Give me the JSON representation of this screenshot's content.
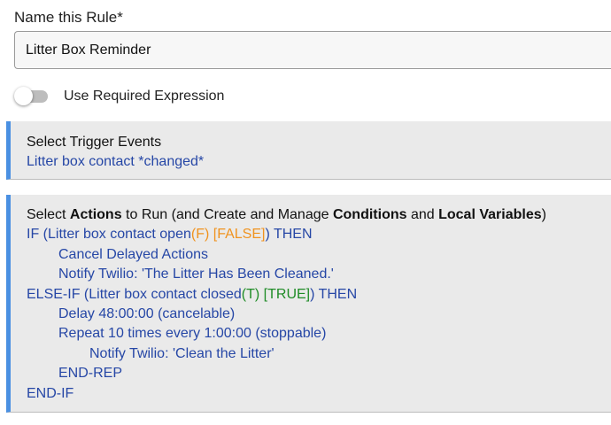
{
  "rule_name": {
    "label": "Name this Rule*",
    "value": "Litter Box Reminder"
  },
  "required_expression": {
    "label": "Use Required Expression",
    "enabled": false
  },
  "trigger_section": {
    "title": "Select Trigger Events",
    "trigger_text": "Litter box contact *changed*"
  },
  "actions_section": {
    "title_parts": {
      "p1": "Select ",
      "b1": "Actions",
      "p2": " to Run (and Create and Manage ",
      "b2": "Conditions",
      "p3": " and ",
      "b3": "Local Variables",
      "p4": ")"
    },
    "lines": [
      {
        "prefix": "IF (Litter box contact open",
        "status": "(F)",
        "value": " [FALSE]",
        "suffix": ") THEN"
      },
      {
        "text": "Cancel Delayed Actions"
      },
      {
        "text": "Notify Twilio: 'The Litter Has Been Cleaned.'"
      },
      {
        "prefix": "ELSE-IF (Litter box contact closed",
        "status": "(T)",
        "value": " [TRUE]",
        "suffix": ") THEN"
      },
      {
        "text": "Delay 48:00:00 (cancelable)"
      },
      {
        "text": "Repeat 10 times every 1:00:00 (stoppable)"
      },
      {
        "text": "Notify Twilio: 'Clean the Litter'"
      },
      {
        "text": "END-REP"
      },
      {
        "text": "END-IF"
      }
    ]
  },
  "colors": {
    "accent_bar": "#4a90e2",
    "action_link": "#2647a6",
    "false_status": "#f0931f",
    "true_status": "#1f8c26"
  }
}
